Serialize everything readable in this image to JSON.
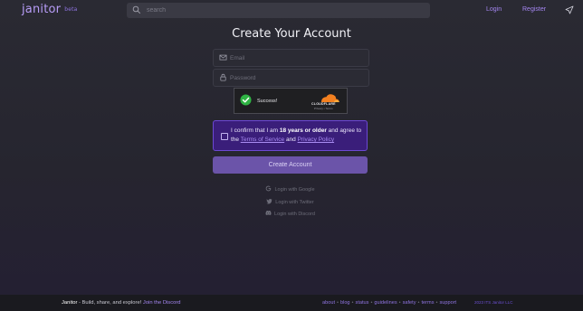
{
  "header": {
    "logo": "janitor",
    "logo_badge": "beta",
    "search_placeholder": "search",
    "login_label": "Login",
    "register_label": "Register",
    "nav_icon": "send-icon"
  },
  "form": {
    "title": "Create Your Account",
    "email_placeholder": "Email",
    "email_icon": "mail-icon",
    "password_placeholder": "Password",
    "password_icon": "lock-icon",
    "captcha": {
      "status": "Success!",
      "brand": "CLOUDFLARE",
      "links": "Privacy • Terms"
    },
    "confirm": {
      "prefix": "I confirm that I am ",
      "age": "18 years or older",
      "middle": " and agree to the ",
      "tos": "Terms of Service",
      "and": " and ",
      "privacy": "Privacy Policy"
    },
    "create_button": "Create Account",
    "social": [
      {
        "label": "Login with Google",
        "icon": "google-icon"
      },
      {
        "label": "Login with Twitter",
        "icon": "twitter-icon"
      },
      {
        "label": "Login with Discord",
        "icon": "discord-icon"
      }
    ]
  },
  "footer": {
    "brand": "Janitor",
    "tagline": " - Build, share, and explore! ",
    "discord_link": "Join the Discord",
    "links": [
      "about",
      "blog",
      "status",
      "guidelines",
      "safety",
      "terms",
      "support"
    ],
    "extra": "2023 ITS Janitor LLC"
  },
  "colors": {
    "accent": "#a486f0",
    "confirm_bg": "#3a1e7a",
    "button_bg": "#6b54a9",
    "success": "#2fb344",
    "cloudflare": "#f38020"
  }
}
